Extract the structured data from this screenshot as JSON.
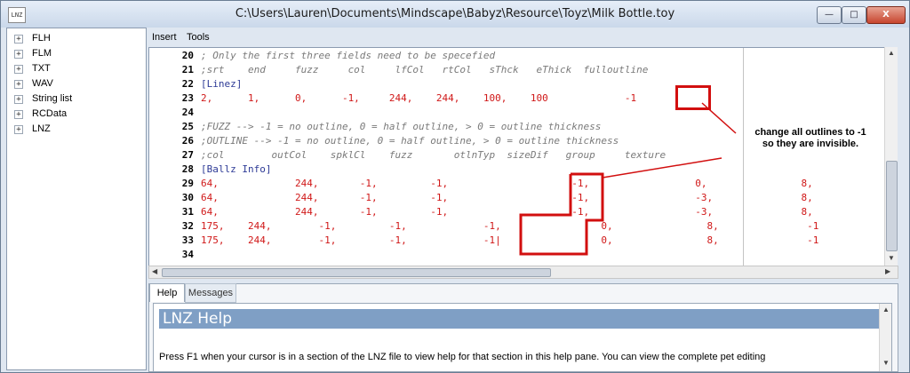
{
  "window": {
    "title": "C:\\Users\\Lauren\\Documents\\Mindscape\\Babyz\\Resource\\Toyz\\Milk Bottle.toy",
    "icon_label": "LNZ",
    "buttons": {
      "minimize": "—",
      "maximize": "□",
      "close": "X"
    }
  },
  "tree": {
    "expander": "+",
    "items": [
      {
        "label": "FLH"
      },
      {
        "label": "FLM"
      },
      {
        "label": "TXT"
      },
      {
        "label": "WAV"
      },
      {
        "label": "String list"
      },
      {
        "label": "RCData"
      },
      {
        "label": "LNZ"
      }
    ]
  },
  "menu": {
    "insert": "Insert",
    "tools": "Tools"
  },
  "editor": {
    "lines": [
      {
        "num": "20",
        "code": "; Only the first three fields need to be specefied",
        "kind": "comment"
      },
      {
        "num": "21",
        "code": ";srt    end     fuzz     col     lfCol   rtCol   sThck   eThick  fulloutline",
        "kind": "comment"
      },
      {
        "num": "22",
        "code": "[Linez]",
        "kind": "section"
      },
      {
        "num": "23",
        "code": "2,      1,      0,      -1,     244,    244,    100,    100             -1",
        "kind": "num"
      },
      {
        "num": "24",
        "code": "",
        "kind": "num"
      },
      {
        "num": "25",
        "code": ";FUZZ --> -1 = no outline, 0 = half outline, > 0 = outline thickness",
        "kind": "comment"
      },
      {
        "num": "26",
        "code": ";OUTLINE --> -1 = no outline, 0 = half outline, > 0 = outline thickness",
        "kind": "comment"
      },
      {
        "num": "27",
        "code": ";col        outCol    spklCl    fuzz       otlnTyp  sizeDif   group     texture",
        "kind": "comment"
      },
      {
        "num": "28",
        "code": "[Ballz Info]",
        "kind": "section"
      },
      {
        "num": "29",
        "code": "64,             244,       -1,         -1,                     -1,                  0,                8,",
        "kind": "num"
      },
      {
        "num": "30",
        "code": "64,             244,       -1,         -1,                     -1,                  -3,               8,",
        "kind": "num"
      },
      {
        "num": "31",
        "code": "64,             244,       -1,         -1,                     -1,                  -3,               8,",
        "kind": "num"
      },
      {
        "num": "32",
        "code": "175,    244,        -1,         -1,             -1,                 0,                8,               -1",
        "kind": "num"
      },
      {
        "num": "33",
        "code": "175,    244,        -1,         -1,             -1|                 0,                8,               -1",
        "kind": "num"
      },
      {
        "num": "34",
        "code": "",
        "kind": "num"
      }
    ]
  },
  "help": {
    "tabs": {
      "help": "Help",
      "messages": "Messages"
    },
    "heading": "LNZ Help",
    "text": "Press F1 when your cursor is in a section of the LNZ file to view help for that section in this help pane. You can view the complete pet editing"
  },
  "annotation": {
    "note_line1": "change all outlines to -1",
    "note_line2": "so they are invisible.",
    "color": "#d20f0f"
  }
}
